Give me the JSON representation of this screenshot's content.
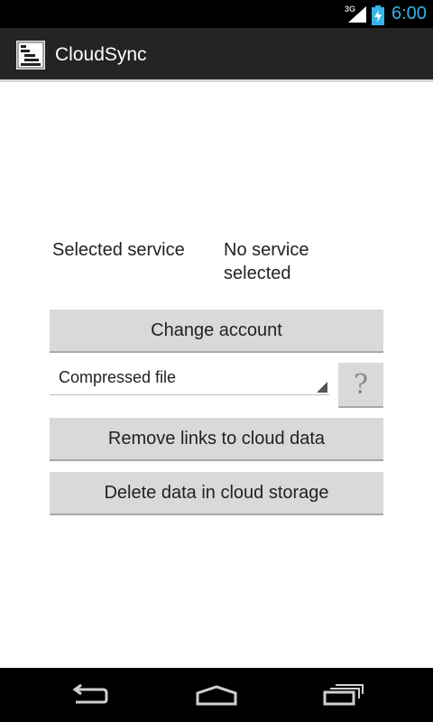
{
  "status_bar": {
    "network": "3G",
    "time": "6:00"
  },
  "app": {
    "title": "CloudSync"
  },
  "service": {
    "label": "Selected service",
    "value_line1": "No service",
    "value_line2": "selected"
  },
  "buttons": {
    "change_account": "Change account",
    "remove_links": "Remove links to cloud data",
    "delete_data": "Delete data in cloud storage"
  },
  "format_spinner": {
    "selected": "Compressed file"
  },
  "help": {
    "glyph": "?"
  },
  "icons": {
    "app": "app-logo-icon",
    "signal": "signal-icon",
    "battery": "battery-charging-icon",
    "back": "back-icon",
    "home": "home-icon",
    "recents": "recent-apps-icon"
  },
  "colors": {
    "clock": "#33b5e5",
    "button": "#d9d9d9",
    "action_bar": "#242424"
  }
}
